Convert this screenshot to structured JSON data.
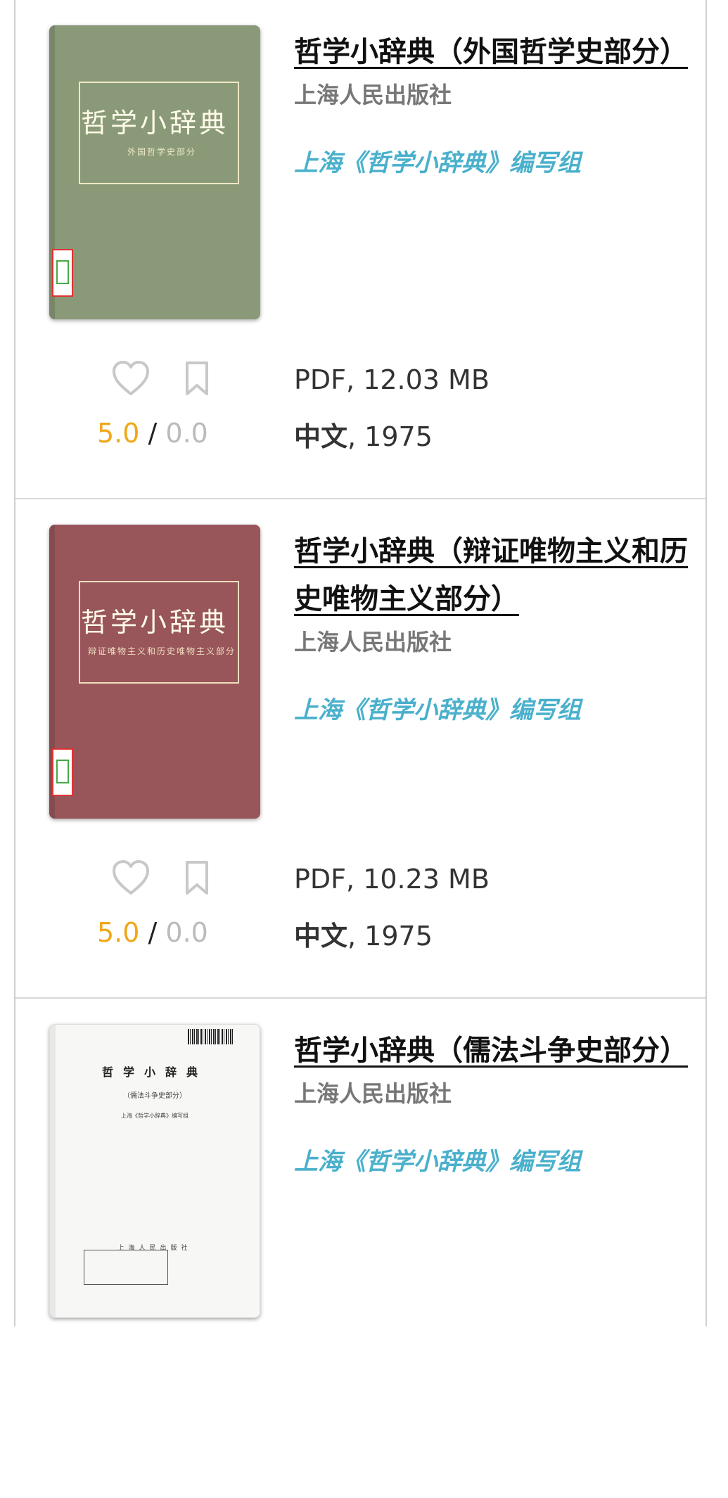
{
  "books": [
    {
      "title": "哲学小辞典（外国哲学史部分）",
      "publisher": "上海人民出版社",
      "author": "上海《哲学小辞典》编写组",
      "file": "PDF, 12.03 MB",
      "language": "中文",
      "year": ", 1975",
      "rating": "5.0",
      "rating_sep": " / ",
      "quality": "0.0",
      "cover": {
        "color": "#8a9a78",
        "title": "哲学小辞典",
        "subtitle": "外国哲学史部分"
      }
    },
    {
      "title": "哲学小辞典（辩证唯物主义和历史唯物主义部分）",
      "publisher": "上海人民出版社",
      "author": "上海《哲学小辞典》编写组",
      "file": "PDF, 10.23 MB",
      "language": "中文",
      "year": ", 1975",
      "rating": "5.0",
      "rating_sep": " / ",
      "quality": "0.0",
      "cover": {
        "color": "#98565a",
        "title": "哲学小辞典",
        "subtitle": "辩证唯物主义和历史唯物主义部分"
      }
    },
    {
      "title": "哲学小辞典（儒法斗争史部分）",
      "publisher": "上海人民出版社",
      "author": "上海《哲学小辞典》编写组",
      "cover": {
        "color": "#f7f7f5",
        "title": "哲学小辞典",
        "subtitle": "（儒法斗争史部分）",
        "subtitle2": "上海《哲学小辞典》编写组",
        "publisher_mark": "上海人民出版社"
      }
    }
  ],
  "colors": {
    "rating": "#f0a818",
    "author_link": "#4ab0cc",
    "publisher": "#777777"
  },
  "icons": [
    "heart-icon",
    "bookmark-icon"
  ]
}
